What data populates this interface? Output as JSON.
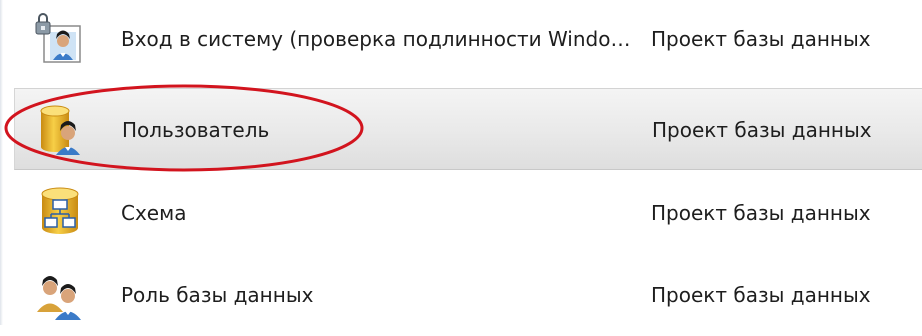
{
  "items": [
    {
      "name": "Вход в систему (проверка подлинности Windo…",
      "category": "Проект базы данных",
      "icon": "login-user-icon",
      "selected": false
    },
    {
      "name": "Пользователь",
      "category": "Проект базы данных",
      "icon": "database-user-icon",
      "selected": true
    },
    {
      "name": "Схема",
      "category": "Проект базы данных",
      "icon": "schema-icon",
      "selected": false
    },
    {
      "name": "Роль базы данных",
      "category": "Проект базы данных",
      "icon": "database-role-icon",
      "selected": false
    }
  ],
  "colors": {
    "annotation": "#d2141e",
    "selected_bg": "#e9e9e9"
  }
}
